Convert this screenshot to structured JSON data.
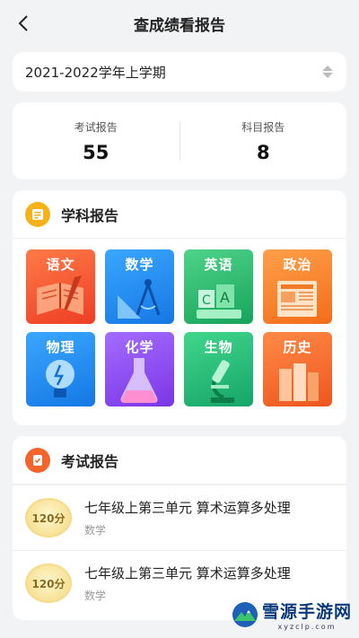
{
  "header": {
    "title": "查成绩看报告"
  },
  "term": {
    "label": "2021-2022学年上学期"
  },
  "stats": [
    {
      "label": "考试报告",
      "value": "55"
    },
    {
      "label": "科目报告",
      "value": "8"
    }
  ],
  "subjects": {
    "title": "学科报告",
    "items": [
      {
        "label": "语文",
        "color": "#f4542e"
      },
      {
        "label": "数学",
        "color": "#1f8ff0"
      },
      {
        "label": "英语",
        "color": "#22b86c"
      },
      {
        "label": "政治",
        "color": "#fb7d25"
      },
      {
        "label": "物理",
        "color": "#1d86ee"
      },
      {
        "label": "化学",
        "color": "#8a4cf0"
      },
      {
        "label": "生物",
        "color": "#21b178"
      },
      {
        "label": "历史",
        "color": "#f46a2b"
      }
    ]
  },
  "exams": {
    "title": "考试报告",
    "items": [
      {
        "score": "120分",
        "title": "七年级上第三单元 算术运算多处理",
        "subject": "数学"
      },
      {
        "score": "120分",
        "title": "七年级上第三单元 算术运算多处理",
        "subject": "数学"
      }
    ]
  },
  "watermark": {
    "title": "雪源手游网",
    "url": "xyzclp.com"
  }
}
